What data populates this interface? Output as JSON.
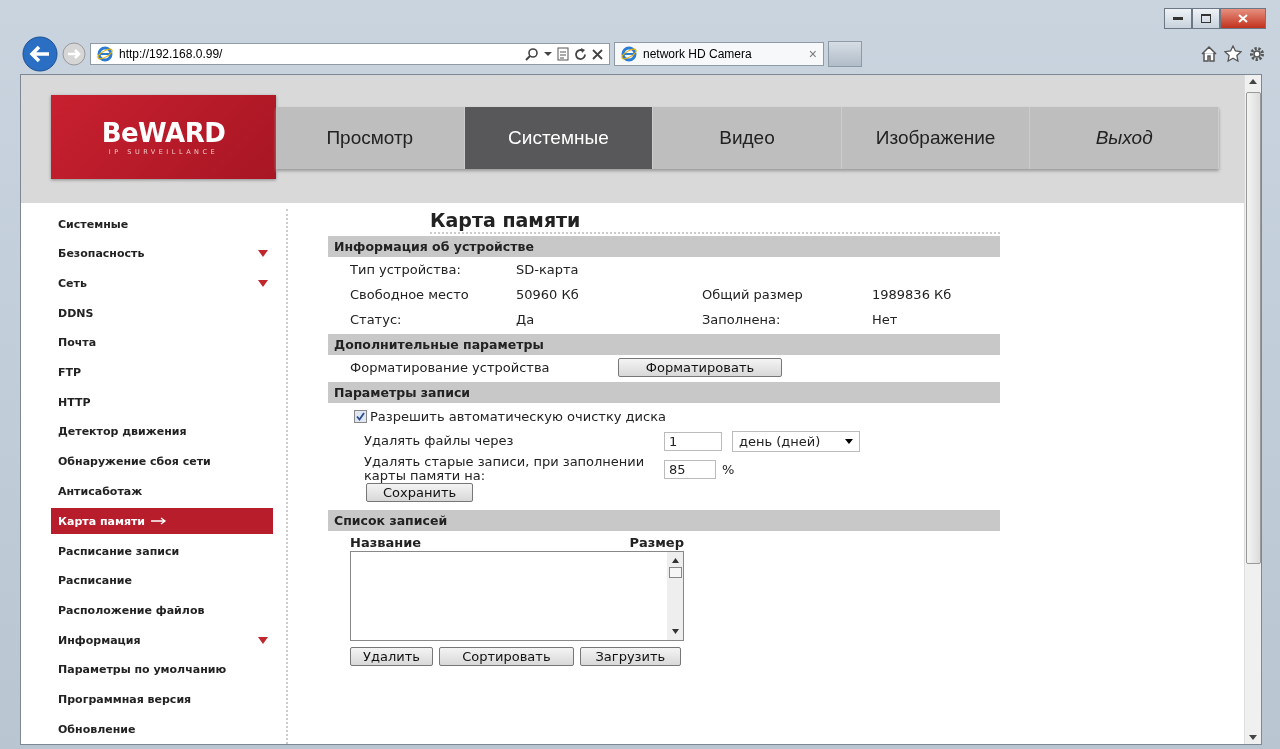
{
  "browser": {
    "address": "http://192.168.0.99/",
    "tab_title": "network HD Camera",
    "close_tab": "×"
  },
  "logo": {
    "brand": "BeWARD",
    "tagline": "IP SURVEILLANCE"
  },
  "nav": [
    {
      "label": "Просмотр",
      "selected": false,
      "kind": "page"
    },
    {
      "label": "Системные",
      "selected": true,
      "kind": "page"
    },
    {
      "label": "Видео",
      "selected": false,
      "kind": "page"
    },
    {
      "label": "Изображение",
      "selected": false,
      "kind": "page"
    },
    {
      "label": "Выход",
      "selected": false,
      "kind": "exit"
    }
  ],
  "sidebar": [
    {
      "label": "Системные",
      "selected": false,
      "has_submenu": false
    },
    {
      "label": "Безопасность",
      "selected": false,
      "has_submenu": true
    },
    {
      "label": "Сеть",
      "selected": false,
      "has_submenu": true
    },
    {
      "label": "DDNS",
      "selected": false,
      "has_submenu": false
    },
    {
      "label": "Почта",
      "selected": false,
      "has_submenu": false
    },
    {
      "label": "FTP",
      "selected": false,
      "has_submenu": false
    },
    {
      "label": "HTTP",
      "selected": false,
      "has_submenu": false
    },
    {
      "label": "Детектор движения",
      "selected": false,
      "has_submenu": false
    },
    {
      "label": "Обнаружение сбоя сети",
      "selected": false,
      "has_submenu": false
    },
    {
      "label": "Антисаботаж",
      "selected": false,
      "has_submenu": false
    },
    {
      "label": "Карта памяти",
      "selected": true,
      "has_submenu": false
    },
    {
      "label": "Расписание записи",
      "selected": false,
      "has_submenu": false
    },
    {
      "label": "Расписание",
      "selected": false,
      "has_submenu": false
    },
    {
      "label": "Расположение файлов",
      "selected": false,
      "has_submenu": false
    },
    {
      "label": "Информация",
      "selected": false,
      "has_submenu": true
    },
    {
      "label": "Параметры по умолчанию",
      "selected": false,
      "has_submenu": false
    },
    {
      "label": "Программная версия",
      "selected": false,
      "has_submenu": false
    },
    {
      "label": "Обновление",
      "selected": false,
      "has_submenu": false
    }
  ],
  "page_title": "Карта памяти",
  "device_info": {
    "title": "Информация об устройстве",
    "rows": [
      {
        "label": "Тип устройства:",
        "value": "SD-карта"
      },
      {
        "label": "Свободное место",
        "value": "50960 Кб",
        "label_2": "Общий размер",
        "value_2": "1989836 Кб"
      },
      {
        "label": "Статус:",
        "value": "Да",
        "label_2": "Заполнена:",
        "value_2": "Нет"
      }
    ]
  },
  "extra": {
    "title": "Дополнительные параметры",
    "label": "Форматирование устройства",
    "button": "Форматировать"
  },
  "recording": {
    "title": "Параметры записи",
    "auto_clean": {
      "label": "Разрешить автоматическую очистку диска",
      "checked": true
    },
    "delete_after": {
      "label": "Удалять файлы через",
      "value": "1",
      "unit": "день (дней)"
    },
    "delete_old": {
      "label": "Удалять старые записи, при заполнении карты памяти на:",
      "value": "85",
      "unit": "%"
    },
    "save": "Сохранить"
  },
  "records": {
    "title": "Список записей",
    "columns": [
      "Название",
      "Размер"
    ],
    "buttons": [
      "Удалить",
      "Сортировать",
      "Загрузить"
    ]
  }
}
